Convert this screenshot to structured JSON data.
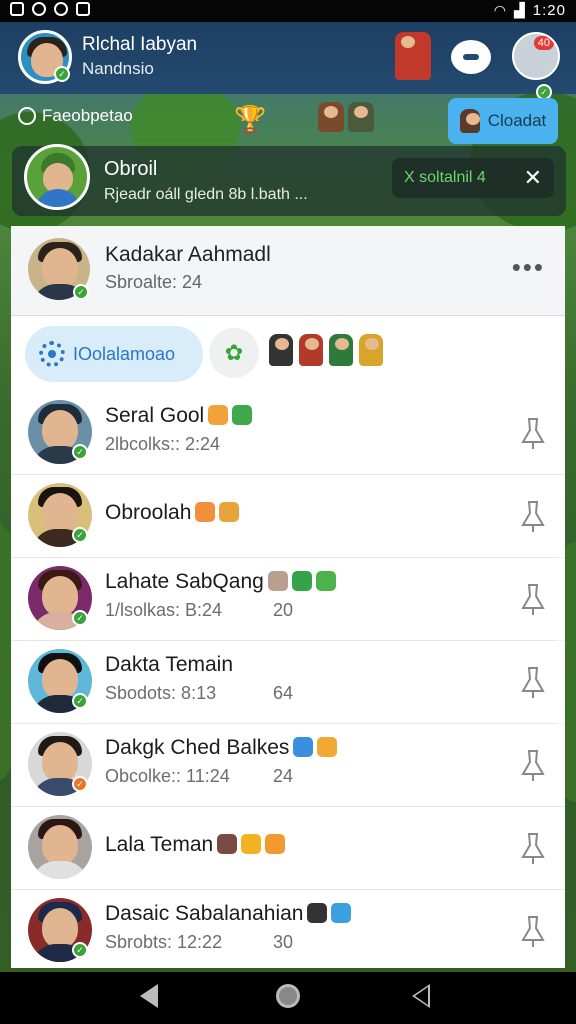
{
  "statusbar": {
    "time": "1:20"
  },
  "header": {
    "user_name": "Rlchal Iabyan",
    "user_sub": "Nandnsio",
    "notification_badge": "40"
  },
  "subbar": {
    "status_label": "Faeobpetao",
    "action_label": "Cloadat"
  },
  "featured": {
    "title": "Obroil",
    "subtitle": "Rjeadr oáll gledn 8b l.bath ...",
    "action_label": "X soltalnil 4"
  },
  "panel_header": {
    "name": "Kadakar Aahmadl",
    "meta": "Sbroalte: 24"
  },
  "filter": {
    "pill_label": "IOolalamoao"
  },
  "contacts": [
    {
      "name": "Seral Gool",
      "meta": "2lbcolks:: 2:24",
      "count": "",
      "emoji_colors": [
        "#f2a23a",
        "#3fa84b"
      ]
    },
    {
      "name": "Obroolah",
      "meta": "",
      "count": "",
      "emoji_colors": [
        "#f0903a",
        "#e9a33d"
      ]
    },
    {
      "name": "Lahate SabQang",
      "meta": "1/lsolkas: B:24",
      "count": "20",
      "emoji_colors": [
        "#b89f90",
        "#36a34b",
        "#4cb34c"
      ]
    },
    {
      "name": "Dakta Temain",
      "meta": "Sbodots: 8:13",
      "count": "64",
      "emoji_colors": []
    },
    {
      "name": "Dakgk Ched Balkes",
      "meta": "Obcolke:: 11:24",
      "count": "24",
      "emoji_colors": [
        "#3b8fe0",
        "#f0a933"
      ]
    },
    {
      "name": "Lala Teman",
      "meta": "",
      "count": "",
      "emoji_colors": [
        "#7a4a45",
        "#f2b222",
        "#f29a30"
      ]
    },
    {
      "name": "Dasaic Sabalanahian",
      "meta": "Sbrobts: 12:22",
      "count": "30",
      "emoji_colors": [
        "#333333",
        "#3aa0e0"
      ]
    }
  ],
  "colors": {
    "header_bg": "#1d3f63",
    "accent_blue": "#4ab3ef",
    "online_green": "#3aa33a",
    "pill_bg": "#d8ecf9"
  }
}
